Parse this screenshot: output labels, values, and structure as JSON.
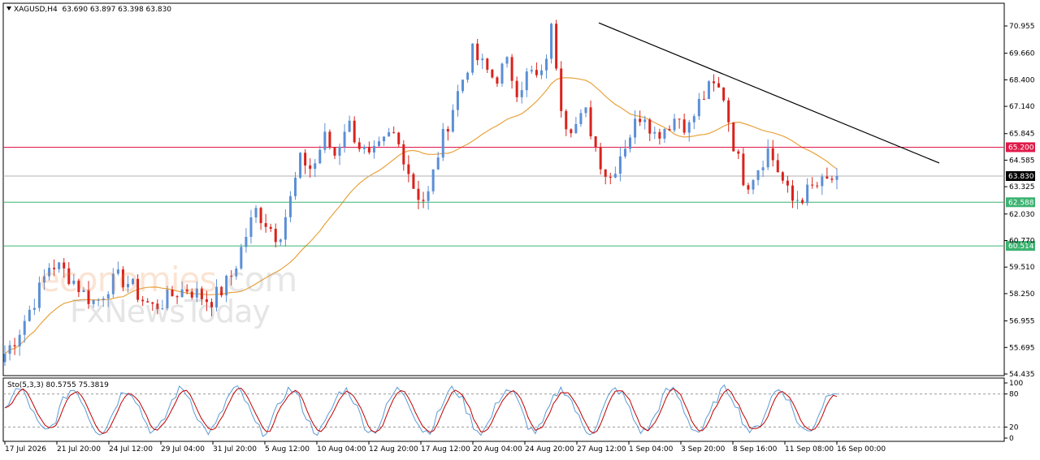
{
  "header": {
    "symbol": "XAGUSD,H4",
    "ohlc": "63.690 63.897 63.398 63.830"
  },
  "stochastic": {
    "label": "Sto(5,3,3) 80.5755 75.3819",
    "levels": [
      100,
      80,
      20,
      0
    ],
    "colors": {
      "main": "#5b9bd5",
      "signal": "#c00000",
      "level": "#999999"
    }
  },
  "watermark": {
    "line1_main": "economies",
    "line1_suffix": ".com",
    "line2": "FxNewsToday"
  },
  "chart_data": {
    "type": "candlestick",
    "symbol": "XAGUSD",
    "timeframe": "H4",
    "price_axis_ticks": [
      "70.955",
      "69.660",
      "68.400",
      "67.140",
      "65.845",
      "64.585",
      "63.325",
      "62.030",
      "60.770",
      "59.510",
      "58.250",
      "56.955",
      "55.695",
      "54.435"
    ],
    "price_range": [
      54.435,
      70.955
    ],
    "time_axis_labels": [
      "17 Jul 2026",
      "21 Jul 20:00",
      "24 Jul 12:00",
      "29 Jul 04:00",
      "31 Jul 20:00",
      "5 Aug 12:00",
      "10 Aug 04:00",
      "12 Aug 20:00",
      "17 Aug 12:00",
      "20 Aug 04:00",
      "24 Aug 20:00",
      "27 Aug 12:00",
      "1 Sep 04:00",
      "3 Sep 20:00",
      "8 Sep 16:00",
      "11 Sep 08:00",
      "16 Sep 00:00"
    ],
    "horizontal_levels": [
      {
        "value": 65.2,
        "label": "65.200",
        "color": "#e0194a"
      },
      {
        "value": 63.83,
        "label": "63.830",
        "color": "#000000"
      },
      {
        "value": 62.588,
        "label": "62.588",
        "color": "#3cb371"
      },
      {
        "value": 60.514,
        "label": "60.514",
        "color": "#3cb371"
      }
    ],
    "trendline": {
      "from_price": 71.1,
      "to_price": 64.45,
      "color": "#000000"
    },
    "moving_average": {
      "color": "#e8a33d"
    },
    "colors": {
      "bull": "#5b8fd6",
      "bear": "#d9221c"
    },
    "candles_close_anchor": [
      {
        "close": 55.4
      },
      {
        "close": 56.2
      },
      {
        "close": 57.3
      },
      {
        "close": 58.4
      },
      {
        "close": 59.7
      },
      {
        "close": 59.4
      },
      {
        "close": 58.9
      },
      {
        "close": 58.2
      },
      {
        "close": 57.8
      },
      {
        "close": 58.6
      },
      {
        "close": 59.0
      },
      {
        "close": 58.7
      },
      {
        "close": 58.0
      },
      {
        "close": 57.6
      },
      {
        "close": 57.9
      },
      {
        "close": 58.3
      },
      {
        "close": 58.5
      },
      {
        "close": 58.2
      },
      {
        "close": 57.9
      },
      {
        "close": 58.4
      },
      {
        "close": 59.2
      },
      {
        "close": 60.8
      },
      {
        "close": 62.2
      },
      {
        "close": 61.6
      },
      {
        "close": 60.9
      },
      {
        "close": 62.6
      },
      {
        "close": 64.7
      },
      {
        "close": 64.1
      },
      {
        "close": 65.7
      },
      {
        "close": 64.8
      },
      {
        "close": 66.5
      },
      {
        "close": 65.4
      },
      {
        "close": 64.6
      },
      {
        "close": 65.2
      },
      {
        "close": 65.9
      },
      {
        "close": 64.8
      },
      {
        "close": 63.1
      },
      {
        "close": 62.6
      },
      {
        "close": 64.9
      },
      {
        "close": 66.6
      },
      {
        "close": 68.2
      },
      {
        "close": 69.7
      },
      {
        "close": 69.0
      },
      {
        "close": 68.4
      },
      {
        "close": 69.2
      },
      {
        "close": 67.9
      },
      {
        "close": 68.8
      },
      {
        "close": 68.3
      },
      {
        "close": 70.9
      },
      {
        "close": 66.5
      },
      {
        "close": 66.2
      },
      {
        "close": 66.8
      },
      {
        "close": 64.9
      },
      {
        "close": 63.6
      },
      {
        "close": 64.9
      },
      {
        "close": 66.0
      },
      {
        "close": 67.0
      },
      {
        "close": 65.8
      },
      {
        "close": 66.2
      },
      {
        "close": 66.7
      },
      {
        "close": 66.1
      },
      {
        "close": 67.4
      },
      {
        "close": 68.1
      },
      {
        "close": 67.8
      },
      {
        "close": 65.2
      },
      {
        "close": 63.4
      },
      {
        "close": 64.2
      },
      {
        "close": 65.1
      },
      {
        "close": 63.9
      },
      {
        "close": 62.6
      },
      {
        "close": 62.9
      },
      {
        "close": 63.3
      },
      {
        "close": 63.5
      },
      {
        "close": 63.83
      }
    ]
  }
}
